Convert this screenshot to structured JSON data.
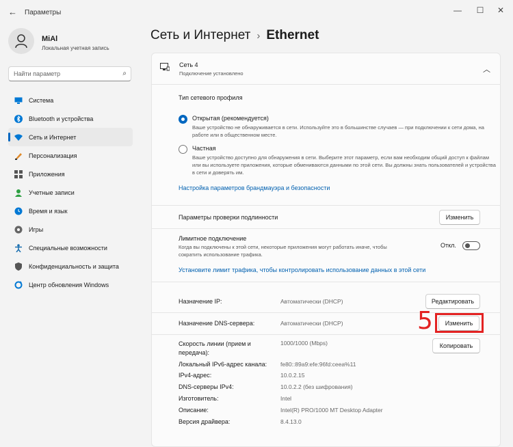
{
  "window": {
    "title": "Параметры"
  },
  "user": {
    "name": "MiAl",
    "account_type": "Локальная учетная запись"
  },
  "search": {
    "placeholder": "Найти параметр"
  },
  "sidebar": {
    "items": [
      {
        "label": "Система",
        "icon": "monitor-icon",
        "color": "#0078d4"
      },
      {
        "label": "Bluetooth и устройства",
        "icon": "bluetooth-icon",
        "color": "#0078d4"
      },
      {
        "label": "Сеть и Интернет",
        "icon": "network-icon",
        "color": "#0078d4",
        "active": true
      },
      {
        "label": "Персонализация",
        "icon": "brush-icon",
        "color": "#e08a2b"
      },
      {
        "label": "Приложения",
        "icon": "apps-icon",
        "color": "#555555"
      },
      {
        "label": "Учетные записи",
        "icon": "account-icon",
        "color": "#2ea043"
      },
      {
        "label": "Время и язык",
        "icon": "globe-clock-icon",
        "color": "#0078d4"
      },
      {
        "label": "Игры",
        "icon": "gamepad-icon",
        "color": "#666666"
      },
      {
        "label": "Специальные возможности",
        "icon": "accessibility-icon",
        "color": "#1a6fb0"
      },
      {
        "label": "Конфиденциальность и защита",
        "icon": "shield-icon",
        "color": "#555555"
      },
      {
        "label": "Центр обновления Windows",
        "icon": "update-icon",
        "color": "#0078d4"
      }
    ]
  },
  "header": {
    "section": "Сеть и Интернет",
    "separator": "›",
    "current": "Ethernet"
  },
  "connection": {
    "name": "Сеть 4",
    "status": "Подключение установлено"
  },
  "profile": {
    "title": "Тип сетевого профиля",
    "public_label": "Открытая (рекомендуется)",
    "public_desc": "Ваше устройство не обнаруживается в сети. Используйте это в большинстве случаев — при подключении к сети дома, на работе или в общественном месте.",
    "private_label": "Частная",
    "private_desc": "Ваше устройство доступно для обнаружения в сети. Выберите этот параметр, если вам необходим общий доступ к файлам или вы используете приложения, которые обмениваются данными по этой сети. Вы должны знать пользователей и устройства в сети и доверять им.",
    "firewall_link": "Настройка параметров брандмауэра и безопасности"
  },
  "auth": {
    "label": "Параметры проверки подлинности",
    "button": "Изменить"
  },
  "metered": {
    "label": "Лимитное подключение",
    "desc": "Когда вы подключены к этой сети, некоторые приложения могут работать иначе, чтобы сократить использование трафика.",
    "state": "Откл.",
    "link": "Установите лимит трафика, чтобы контролировать использование данных в этой сети"
  },
  "ip": {
    "label": "Назначение IP:",
    "value": "Автоматически (DHCP)",
    "button": "Редактировать"
  },
  "dns": {
    "label": "Назначение DNS-сервера:",
    "value": "Автоматически (DHCP)",
    "button": "Изменить"
  },
  "details": {
    "copy_button": "Копировать",
    "speed_label": "Скорость линии (прием и передача):",
    "speed_value": "1000/1000 (Mbps)",
    "ipv6_label": "Локальный IPv6-адрес канала:",
    "ipv6_value": "fe80::89a9:efe:96fd:ceea%11",
    "ipv4_label": "IPv4-адрес:",
    "ipv4_value": "10.0.2.15",
    "dns_label": "DNS-серверы IPv4:",
    "dns_value": "10.0.2.2 (без шифрования)",
    "mfr_label": "Изготовитель:",
    "mfr_value": "Intel",
    "desc_label": "Описание:",
    "desc_value": "Intel(R) PRO/1000 MT Desktop Adapter",
    "driver_label": "Версия драйвера:",
    "driver_value": "8.4.13.0"
  },
  "annotation": {
    "number": "5"
  }
}
